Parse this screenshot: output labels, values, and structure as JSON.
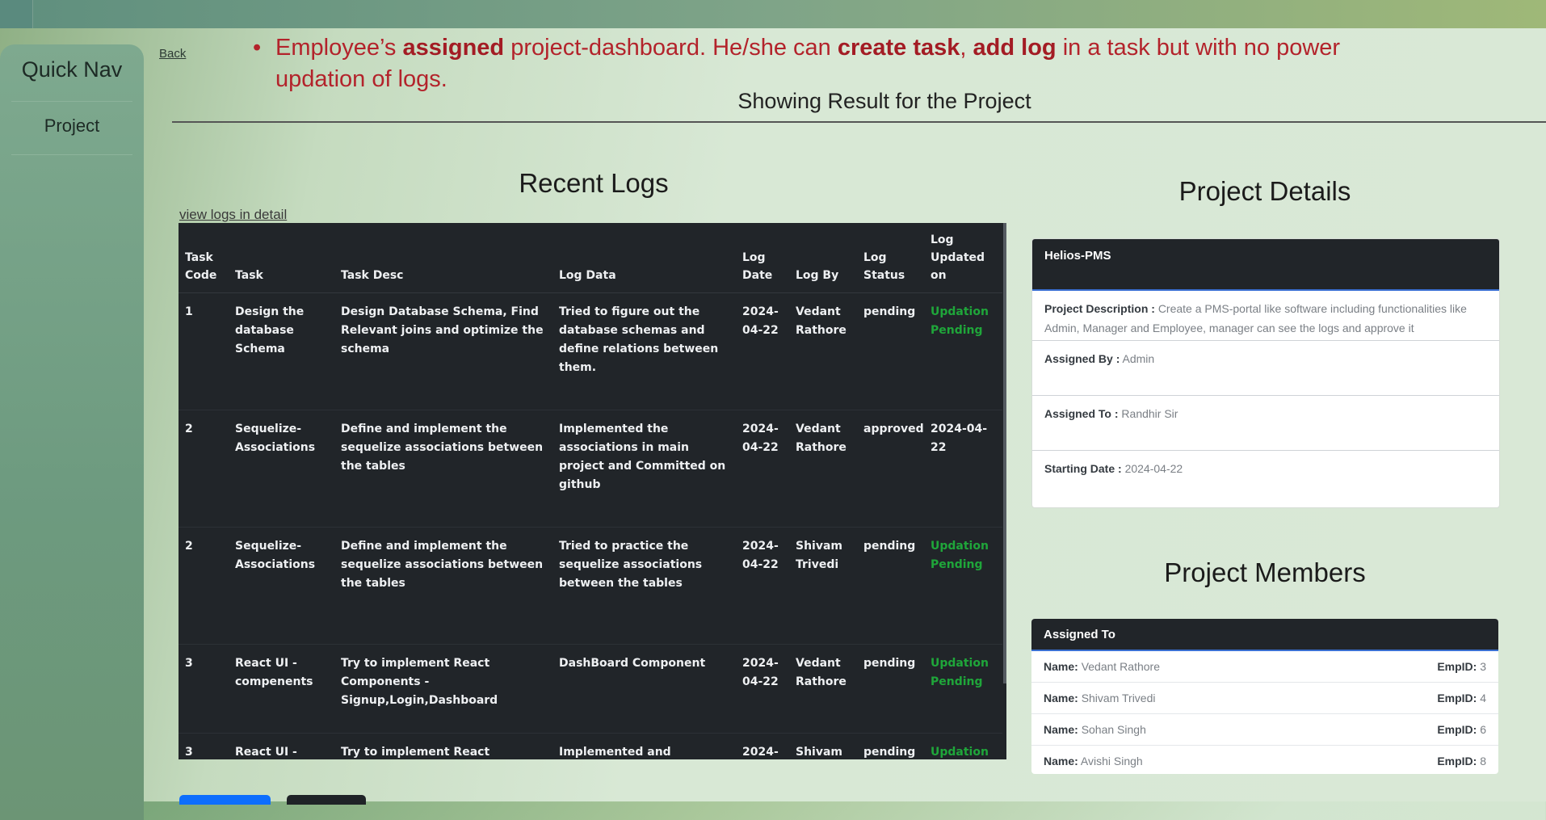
{
  "sidebar": {
    "title": "Quick Nav",
    "items": [
      {
        "label": "Project"
      }
    ]
  },
  "nav": {
    "back_label": "Back"
  },
  "note": {
    "parts": [
      {
        "text": "Employee’s ",
        "bold": false
      },
      {
        "text": "assigned",
        "bold": true
      },
      {
        "text": " project-dashboard. He/she can ",
        "bold": false
      },
      {
        "text": "create task",
        "bold": true
      },
      {
        "text": ", ",
        "bold": false
      },
      {
        "text": "add log",
        "bold": true
      },
      {
        "text": " in a task but with no power updation of logs.",
        "bold": false
      }
    ]
  },
  "result_title": "Showing Result for the Project",
  "recent_logs": {
    "title": "Recent Logs",
    "view_link": "view logs in detail",
    "columns": [
      "Task Code",
      "Task",
      "Task Desc",
      "Log Data",
      "Log Date",
      "Log By",
      "Log Status",
      "Log Updated on"
    ],
    "rows": [
      {
        "code": "1",
        "task": "Design the database Schema",
        "desc": "Design Database Schema, Find Relevant joins and optimize the schema",
        "log": "Tried to figure out the database schemas and define relations between them.",
        "date": "2024-04-22",
        "by": "Vedant Rathore",
        "status": "pending",
        "updated": "Updation Pending"
      },
      {
        "code": "2",
        "task": "Sequelize-Associations",
        "desc": "Define and implement the sequelize associations between the tables",
        "log": "Implemented the associations in main project and Committed on github",
        "date": "2024-04-22",
        "by": "Vedant Rathore",
        "status": "approved",
        "updated": "2024-04-22"
      },
      {
        "code": "2",
        "task": "Sequelize-Associations",
        "desc": "Define and implement the sequelize associations between the tables",
        "log": "Tried to practice the sequelize associations between the tables",
        "date": "2024-04-22",
        "by": "Shivam Trivedi",
        "status": "pending",
        "updated": "Updation Pending"
      },
      {
        "code": "3",
        "task": "React UI - compenents",
        "desc": "Try to implement React Components - Signup,Login,Dashboard",
        "log": "DashBoard Component",
        "date": "2024-04-22",
        "by": "Vedant Rathore",
        "status": "pending",
        "updated": "Updation Pending"
      },
      {
        "code": "3",
        "task": "React UI -",
        "desc": "Try to implement React Components",
        "log": "Implemented and designed",
        "date": "2024-",
        "by": "Shivam",
        "status": "pending",
        "updated": "Updation"
      }
    ]
  },
  "project_details": {
    "title": "Project Details",
    "name": "Helios-PMS",
    "description_label": "Project Description :",
    "description": "Create a PMS-portal like software including functionalities like Admin, Manager and Employee, manager can see the logs and approve it",
    "assigned_by_label": "Assigned By :",
    "assigned_by": "Admin",
    "assigned_to_label": "Assigned To :",
    "assigned_to": "Randhir Sir",
    "starting_date_label": "Starting Date :",
    "starting_date": "2024-04-22"
  },
  "project_members": {
    "title": "Project Members",
    "header": "Assigned To",
    "name_label": "Name:",
    "emp_label": "EmpID:",
    "members": [
      {
        "name": "Vedant Rathore",
        "empid": "3"
      },
      {
        "name": "Shivam Trivedi",
        "empid": "4"
      },
      {
        "name": "Sohan Singh",
        "empid": "6"
      },
      {
        "name": "Avishi Singh",
        "empid": "8"
      }
    ]
  },
  "colors": {
    "note_text": "#b3232b",
    "status_updation_pending": "#1fa63a",
    "table_bg": "#212529"
  }
}
